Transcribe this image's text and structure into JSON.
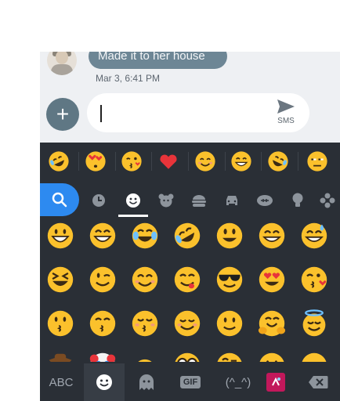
{
  "conversation": {
    "message_text": "Made it to her house",
    "timestamp": "Mar 3, 6:41 PM"
  },
  "compose": {
    "send_label": "SMS"
  },
  "keyboard": {
    "recent_emojis": [
      "rolling-on-floor-laughing",
      "face-blowing-kiss-hearts",
      "face-blowing-a-kiss",
      "red-heart",
      "smiling-face",
      "grinning-squinting",
      "rolling-on-floor-laughing-tilted",
      "unamused-face"
    ],
    "categories": [
      "search-icon",
      "clock-icon",
      "smiley-icon",
      "animal-icon",
      "food-icon",
      "car-icon",
      "activity-icon",
      "lightbulb-icon",
      "flags-icon"
    ],
    "active_category": "smiley-icon",
    "grid_emojis": [
      [
        "grinning-face",
        "grinning-big-eyes",
        "face-with-tears-of-joy",
        "rolling-on-floor-laughing",
        "smiling-big-eyes",
        "grinning-squinting",
        "grinning-sweat"
      ],
      [
        "laughing-squinting",
        "winking-face",
        "smiling-eyes",
        "face-savoring-food",
        "smiling-sunglasses",
        "heart-eyes",
        "face-blowing-a-kiss"
      ],
      [
        "kissing-face",
        "kissing-smiling-eyes",
        "kissing-closed-eyes",
        "smiling-face",
        "slightly-smiling",
        "hugging-face",
        "smiling-halo"
      ],
      [
        "cowboy-face",
        "clown-face",
        "face-partial",
        "nerd-face",
        "face-raised-eyebrow",
        "neutral-face",
        "expressionless-face"
      ]
    ],
    "bottom_bar": {
      "abc_label": "ABC",
      "gif_label": "GIF",
      "kaomoji_label": "(^_^)"
    },
    "colors": {
      "background": "#2a2f36",
      "search_accent": "#2d8af0",
      "emoji_yellow": "#fbc12c"
    }
  }
}
